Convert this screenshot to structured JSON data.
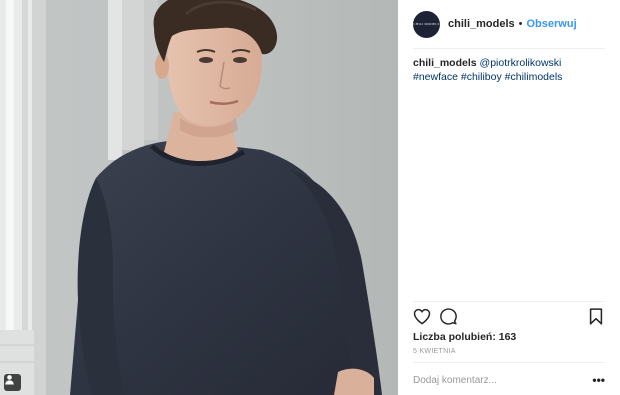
{
  "post": {
    "image_alt": "",
    "user_tag_icon": "person-icon"
  },
  "header": {
    "avatar_text": "CHILI MODELS",
    "username": "chili_models",
    "separator": "•",
    "follow_label": "Obserwuj"
  },
  "caption": {
    "username": "chili_models",
    "mention": "@piotrkrolikowski",
    "tags": [
      "#newface",
      "#chiliboy",
      "#chilimodels"
    ]
  },
  "actions": {
    "like_icon": "heart-icon",
    "comment_icon": "comment-icon",
    "save_icon": "bookmark-icon"
  },
  "stats": {
    "likes_label": "Liczba polubień: 163",
    "date": "5 KWIETNIA"
  },
  "comment": {
    "placeholder": "Dodaj komentarz...",
    "more_label": "•••"
  },
  "colors": {
    "link": "#003569",
    "follow": "#3897f0",
    "muted": "#999999",
    "text": "#262626",
    "avatar_bg": "#1e2235"
  }
}
